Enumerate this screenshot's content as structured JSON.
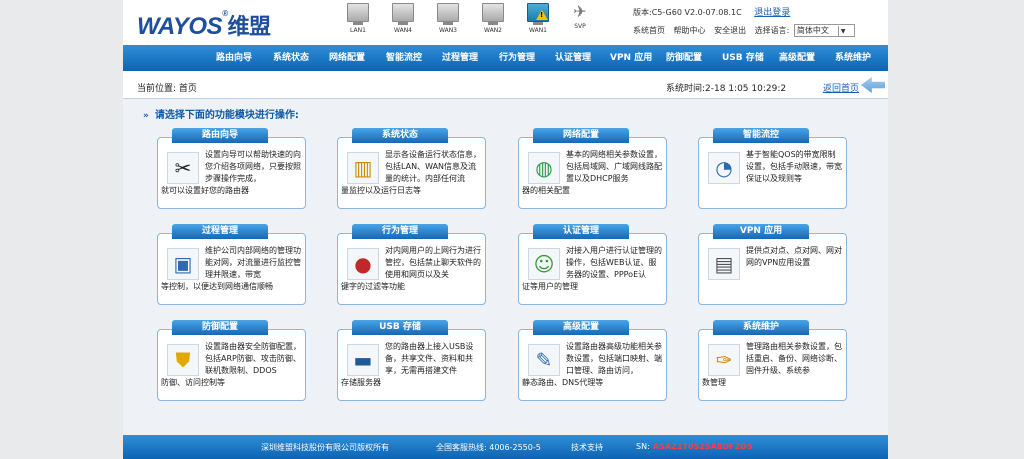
{
  "brand": {
    "name": "WAYOS",
    "reg": "®",
    "name_cn": "维盟"
  },
  "ports": [
    {
      "label": "LAN1",
      "icon": "monitor-icon"
    },
    {
      "label": "WAN4",
      "icon": "monitor-icon"
    },
    {
      "label": "WAN3",
      "icon": "monitor-icon"
    },
    {
      "label": "WAN2",
      "icon": "monitor-icon"
    },
    {
      "label": "WAN1",
      "icon": "monitor-warning-icon"
    },
    {
      "label": "SVP",
      "icon": "satellite-icon"
    }
  ],
  "header": {
    "version": "版本:C5-G60 V2.0-07.08.1C",
    "logout": "退出登录",
    "links": [
      "系统首页",
      "帮助中心",
      "安全退出"
    ],
    "lang_label": "选择语言:",
    "lang_value": "简体中文"
  },
  "nav": [
    "路由向导",
    "系统状态",
    "网络配置",
    "智能流控",
    "过程管理",
    "行为管理",
    "认证管理",
    "VPN 应用",
    "防御配置",
    "USB 存储",
    "高级配置",
    "系统维护"
  ],
  "location": {
    "here": "当前位置: 首页",
    "time": "系统时间:2-18  1:05  10:29:2",
    "back": "返回首页"
  },
  "prompt": "请选择下面的功能模块进行操作:",
  "cards": [
    {
      "title": "路由向导",
      "icon": "tools-icon",
      "glyph": "✂",
      "desc": "设置向导可以帮助快速的向您介绍各项网络，只要按照步骤操作完成，",
      "desc2": "就可以设置好您的路由器"
    },
    {
      "title": "系统状态",
      "icon": "status-chart-icon",
      "glyph": "▥",
      "desc": "显示各设备运行状态信息，包括LAN、WAN信息及流量的统计。内部任何流",
      "desc2": "量监控以及运行日志等"
    },
    {
      "title": "网络配置",
      "icon": "globe-icon",
      "glyph": "◍",
      "desc": "基本的网络相关参数设置，包括局域网、广域网线路配置以及DHCP服务",
      "desc2": "器的相关配置"
    },
    {
      "title": "智能流控",
      "icon": "flow-control-icon",
      "glyph": "◔",
      "desc": "基于智能QOS的带宽限制设置，包括手动限速，带宽保证以及规则等",
      "desc2": ""
    },
    {
      "title": "过程管理",
      "icon": "remote-manage-icon",
      "glyph": "▣",
      "desc": "维护公司内部网络的管理功能对网，对流量进行监控管理并限速，带宽",
      "desc2": "等控制，以便达到网络通信顺畅"
    },
    {
      "title": "行为管理",
      "icon": "ladybug-icon",
      "glyph": "●",
      "desc": "对内网用户的上网行为进行管控，包括禁止聊天软件的使用和网页以及关",
      "desc2": "键字的过滤等功能"
    },
    {
      "title": "认证管理",
      "icon": "users-icon",
      "glyph": "☺",
      "desc": "对接入用户进行认证管理的操作，包括WEB认证、服务器的设置、PPPoE认",
      "desc2": "证等用户的管理"
    },
    {
      "title": "VPN 应用",
      "icon": "vpn-server-icon",
      "glyph": "▤",
      "desc": "提供点对点、点对网、网对网的VPN应用设置",
      "desc2": ""
    },
    {
      "title": "防御配置",
      "icon": "shield-icon",
      "glyph": "⛊",
      "desc": "设置路由器安全防御配置，包括ARP防御、攻击防御、联机数限制、DDOS",
      "desc2": "防御、访问控制等"
    },
    {
      "title": "USB 存储",
      "icon": "usb-drive-icon",
      "glyph": "▬",
      "desc": "您的路由器上接入USB设备，共享文件、资料和共享，无需再搭建文件",
      "desc2": "存储服务器"
    },
    {
      "title": "高级配置",
      "icon": "advanced-tools-icon",
      "glyph": "✎",
      "desc": "设置路由器高级功能相关参数设置，包括端口映射、端口管理、路由访问，",
      "desc2": "静态路由、DNS代理等"
    },
    {
      "title": "系统维护",
      "icon": "wrench-icon",
      "glyph": "✑",
      "desc": "管理路由相关参数设置，包括重启、备份、网络诊断、固件升级、系统参",
      "desc2": "数管理"
    }
  ],
  "footer": {
    "company": "深圳维盟科技股份有限公司版权所有",
    "hotline": "全国客服热线: 4006-2550-5",
    "support": "技术支持",
    "sn_label": "SN:",
    "sn_value": "ASAZ1T0S2SA8DF2DS"
  }
}
